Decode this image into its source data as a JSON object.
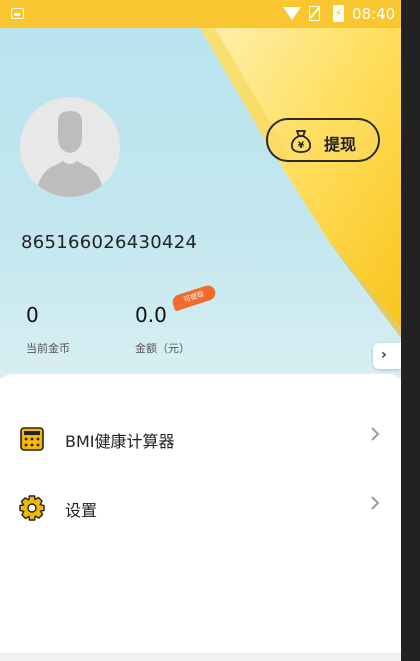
{
  "status_bar": {
    "time": "08:40",
    "battery_glyph": "⚡"
  },
  "header": {
    "withdraw_label": "提现",
    "user_id": "865166026430424"
  },
  "stats": {
    "coins_value": "0",
    "coins_label": "当前金币",
    "amount_value": "0.0",
    "amount_label": "金额（元）",
    "amount_badge": "可提现"
  },
  "menu": [
    {
      "label": "BMI健康计算器",
      "icon": "calculator-icon"
    },
    {
      "label": "设置",
      "icon": "gear-icon"
    }
  ],
  "colors": {
    "status_bar": "#f9c531",
    "header_bg": "#bfe5ef",
    "badge": "#f06b2c",
    "icon": "#f5b800"
  }
}
